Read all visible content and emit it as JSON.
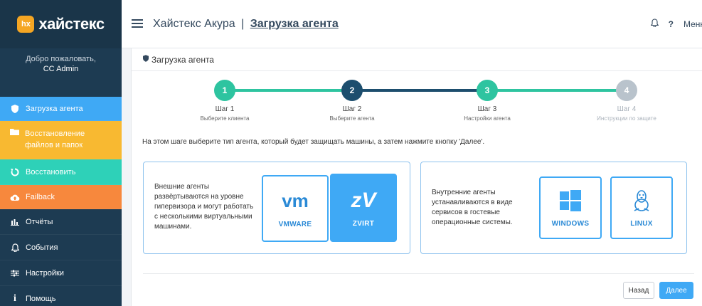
{
  "brand": {
    "badge": "hx",
    "name": "хайстекс"
  },
  "welcome": {
    "greeting": "Добро пожаловать,",
    "user": "CC Admin"
  },
  "sidebar": {
    "items": [
      {
        "label": "Загрузка агента",
        "icon": "shield-icon",
        "color": "#3fa9f5"
      },
      {
        "label": "Восстановление файлов и папок",
        "icon": "folder-icon",
        "color": "#f8b931"
      },
      {
        "label": "Восстановить",
        "icon": "restore-icon",
        "color": "#2ed1b8"
      },
      {
        "label": "Failback",
        "icon": "cloud-upload-icon",
        "color": "#f7883d"
      },
      {
        "label": "Отчёты",
        "icon": "bar-chart-icon"
      },
      {
        "label": "События",
        "icon": "bell-icon"
      },
      {
        "label": "Настройки",
        "icon": "sliders-icon"
      },
      {
        "label": "Помощь",
        "icon": "info-icon"
      }
    ]
  },
  "header": {
    "app": "Хайстекс Акура",
    "separator": "|",
    "current": "Загрузка агента",
    "help": "?",
    "menu": "Меню"
  },
  "card": {
    "title": "Загрузка агента"
  },
  "steps": [
    {
      "num": "1",
      "label": "Шаг 1",
      "sub": "Выберите клиента",
      "color": "#2ec4a0"
    },
    {
      "num": "2",
      "label": "Шаг 2",
      "sub": "Выберите агента",
      "color": "#1d4e6e"
    },
    {
      "num": "3",
      "label": "Шаг 3",
      "sub": "Настройки агента",
      "color": "#2ec4a0"
    },
    {
      "num": "4",
      "label": "Шаг 4",
      "sub": "Инструкции по защите",
      "color": "#b9c3cc"
    }
  ],
  "instruction": "На этом шаге выберите тип агента, который будет защищать машины, а затем нажмите кнопку 'Далее'.",
  "external": {
    "text": "Внешние агенты развёртываются на уровне гипервизора и могут работать с несколькими виртуальными машинами.",
    "tiles": [
      {
        "icon_text": "vm",
        "icon": "vmware-logo-icon",
        "label": "VMWARE",
        "selected": false
      },
      {
        "icon_text": "zV",
        "icon": "zvirt-logo-icon",
        "label": "ZVIRT",
        "selected": true
      }
    ]
  },
  "internal": {
    "text": "Внутренние агенты устанавливаются в виде сервисов в гостевые операционные системы.",
    "tiles": [
      {
        "icon": "windows-logo-icon",
        "label": "WINDOWS",
        "selected": false
      },
      {
        "icon": "linux-tux-icon",
        "label": "LINUX",
        "selected": false
      }
    ]
  },
  "buttons": {
    "back": "Назад",
    "next": "Далее"
  }
}
